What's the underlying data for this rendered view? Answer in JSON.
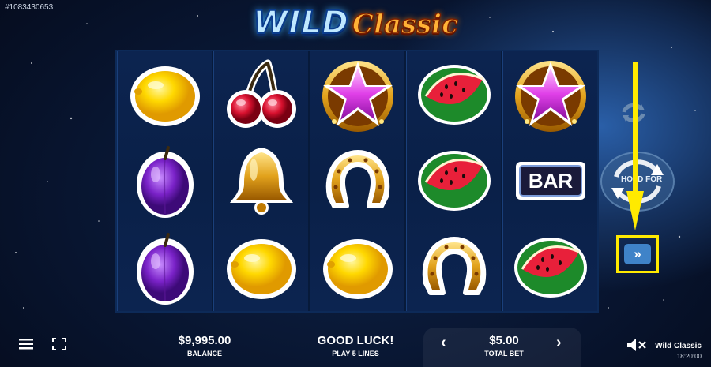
{
  "round_id": "#1083430653",
  "logo": {
    "wild": "WILD",
    "classic": "Classic"
  },
  "reels": [
    [
      "lemon",
      "plum",
      "plum"
    ],
    [
      "cherry",
      "bell",
      "lemon"
    ],
    [
      "star",
      "horseshoe",
      "lemon"
    ],
    [
      "watermelon",
      "watermelon",
      "horseshoe"
    ],
    [
      "star",
      "bar",
      "watermelon"
    ]
  ],
  "bar_text": "BAR",
  "spin": {
    "label": "HOLD FOR"
  },
  "bottom": {
    "balance_value": "$9,995.00",
    "balance_label": "BALANCE",
    "message": "GOOD LUCK!",
    "lines": "PLAY 5 LINES",
    "bet_value": "$5.00",
    "bet_label": "TOTAL BET",
    "prev": "‹",
    "next": "›",
    "game_name": "Wild Classic",
    "clock": "18:20:00"
  },
  "icons": {
    "menu": "hamburger-icon",
    "fullscreen": "fullscreen-icon",
    "sound": "sound-muted-icon",
    "turbo": "fast-forward-icon",
    "autoplay": "autoplay-icon"
  },
  "colors": {
    "highlight": "#ffea00",
    "accent": "#3f83c8"
  }
}
